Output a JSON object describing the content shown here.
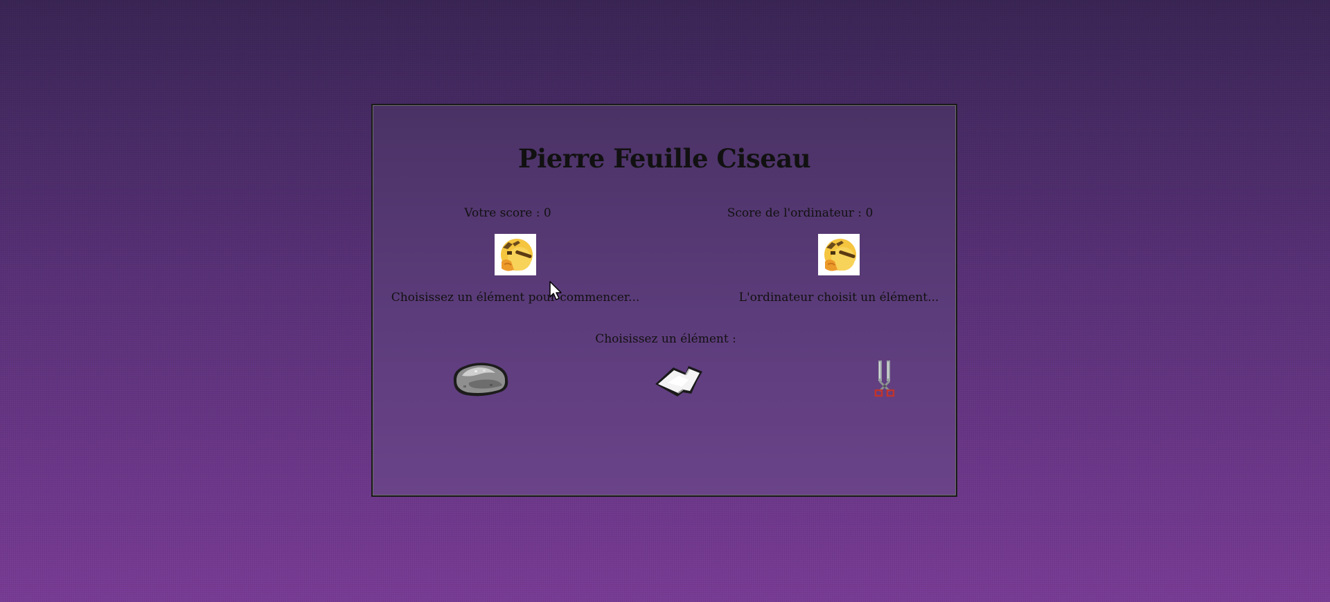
{
  "game": {
    "title": "Pierre Feuille Ciseau",
    "player_score_label": "Votre score : 0",
    "cpu_score_label": "Score de l'ordinateur : 0",
    "player_message": "Choisissez un élément pour commencer...",
    "cpu_message": "L'ordinateur choisit un élément...",
    "choose_label": "Choisissez un élément :"
  },
  "choices": [
    {
      "id": "rock",
      "icon": "rock-icon"
    },
    {
      "id": "paper",
      "icon": "paper-icon"
    },
    {
      "id": "scissors",
      "icon": "scissors-icon"
    }
  ],
  "icons": {
    "player_avatar": "thinking-emoji-icon",
    "cpu_avatar": "thinking-emoji-icon"
  },
  "colors": {
    "background_top": "#3b2657",
    "background_bottom": "#7b3d98",
    "panel": "#5a3a78",
    "text": "#111111"
  }
}
